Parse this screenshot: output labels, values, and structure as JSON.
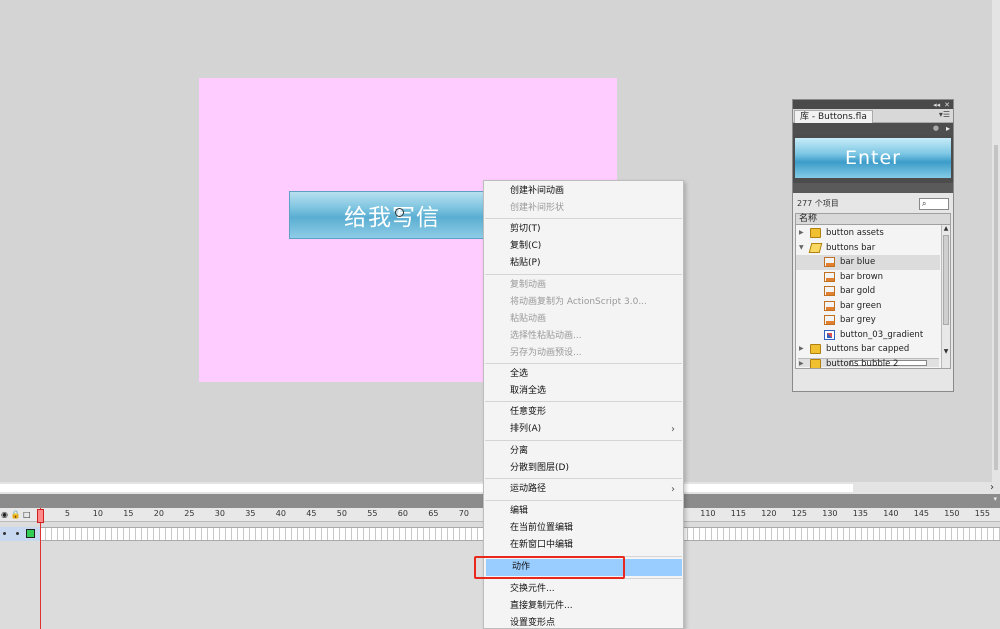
{
  "stage": {
    "button_text": "给我写信",
    "background_color": "#ffccff"
  },
  "library": {
    "tab_title": "库 - Buttons.fla",
    "preview_text": "Enter",
    "item_count": "277 个项目",
    "search_icon": "magnifier-icon",
    "column_name": "名称",
    "items": [
      {
        "label": "button assets",
        "type": "folder",
        "expanded": false
      },
      {
        "label": "buttons bar",
        "type": "folder",
        "expanded": true
      },
      {
        "label": "bar blue",
        "type": "symbol",
        "selected": true
      },
      {
        "label": "bar brown",
        "type": "symbol"
      },
      {
        "label": "bar gold",
        "type": "symbol"
      },
      {
        "label": "bar green",
        "type": "symbol"
      },
      {
        "label": "bar grey",
        "type": "symbol"
      },
      {
        "label": "button_03_gradient",
        "type": "bitmap"
      },
      {
        "label": "buttons bar capped",
        "type": "folder",
        "expanded": false
      },
      {
        "label": "buttons bubble 2",
        "type": "folder",
        "expanded": false
      }
    ]
  },
  "timeline": {
    "frame_labels": [
      "1",
      "5",
      "10",
      "15",
      "20",
      "25",
      "30",
      "35",
      "40",
      "45",
      "50",
      "55",
      "60",
      "65",
      "70",
      "110",
      "115",
      "120",
      "125",
      "130",
      "135",
      "140",
      "145",
      "150",
      "155"
    ],
    "current_frame": "1"
  },
  "context_menu": {
    "items": [
      {
        "label": "创建补间动画",
        "enabled": true
      },
      {
        "label": "创建补间形状",
        "enabled": false
      },
      {
        "label": "剪切(T)",
        "enabled": true
      },
      {
        "label": "复制(C)",
        "enabled": true
      },
      {
        "label": "粘贴(P)",
        "enabled": true
      },
      {
        "label": "复制动画",
        "enabled": false
      },
      {
        "label": "将动画复制为 ActionScript 3.0...",
        "enabled": false
      },
      {
        "label": "粘贴动画",
        "enabled": false
      },
      {
        "label": "选择性粘贴动画...",
        "enabled": false
      },
      {
        "label": "另存为动画预设...",
        "enabled": false
      },
      {
        "label": "全选",
        "enabled": true
      },
      {
        "label": "取消全选",
        "enabled": true
      },
      {
        "label": "任意变形",
        "enabled": true
      },
      {
        "label": "排列(A)",
        "enabled": true,
        "submenu": true
      },
      {
        "label": "分离",
        "enabled": true
      },
      {
        "label": "分散到图层(D)",
        "enabled": true
      },
      {
        "label": "运动路径",
        "enabled": true,
        "submenu": true
      },
      {
        "label": "编辑",
        "enabled": true
      },
      {
        "label": "在当前位置编辑",
        "enabled": true
      },
      {
        "label": "在新窗口中编辑",
        "enabled": true
      },
      {
        "label": "动作",
        "enabled": true,
        "highlighted": true
      },
      {
        "label": "交换元件...",
        "enabled": true
      },
      {
        "label": "直接复制元件...",
        "enabled": true
      },
      {
        "label": "设置变形点",
        "enabled": true
      }
    ],
    "submenu_glyph": "›"
  },
  "colors": {
    "highlight_box": "#e8281c",
    "menu_highlight": "#99ccff",
    "playhead": "#e03030"
  }
}
